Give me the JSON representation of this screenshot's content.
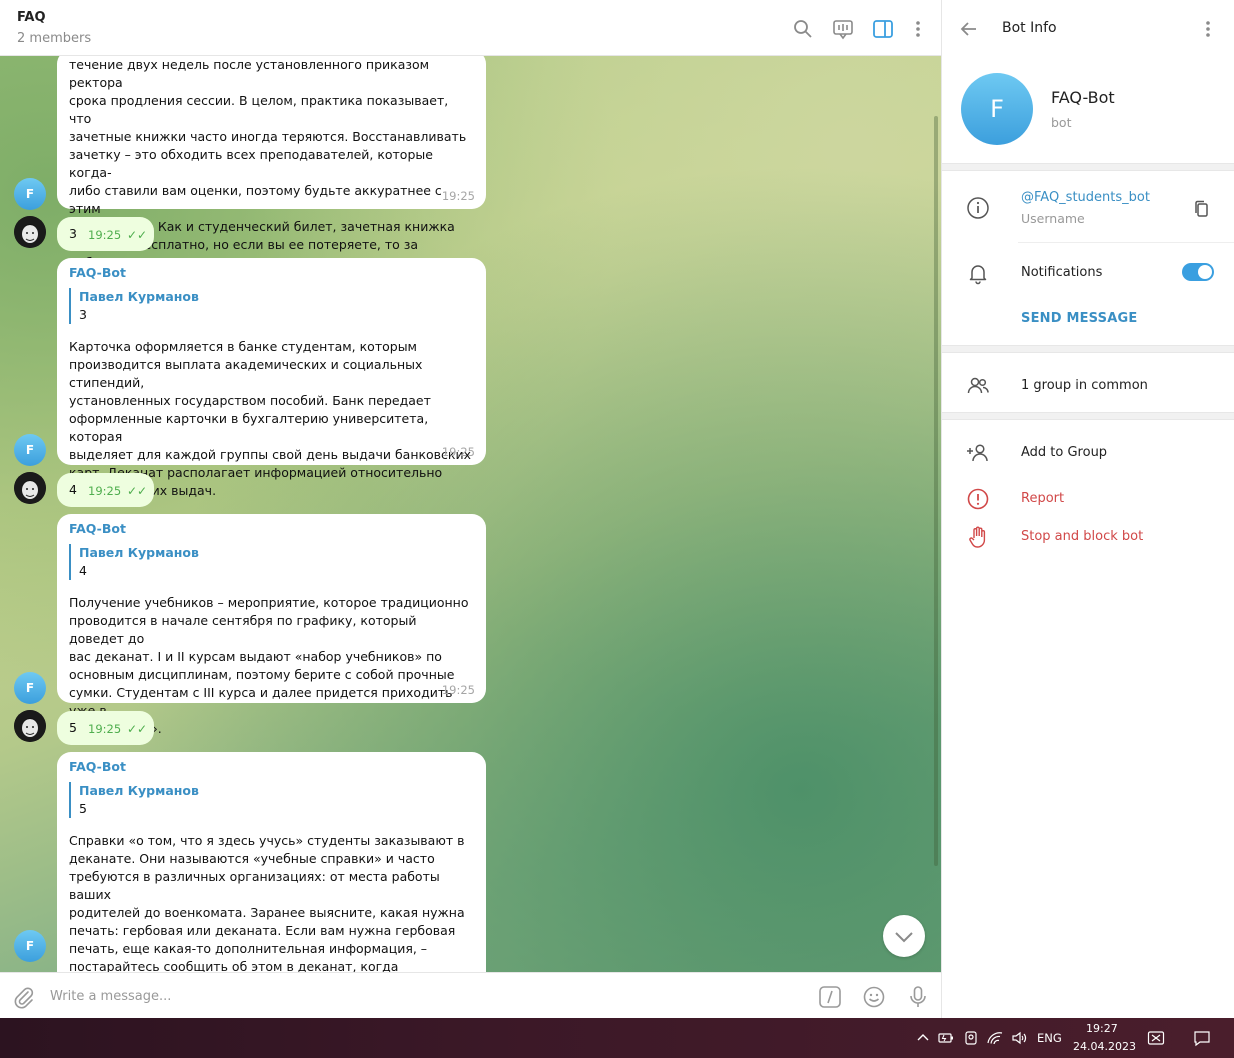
{
  "chat": {
    "title": "FAQ",
    "subtitle": "2 members",
    "header_icons": [
      "search-icon",
      "video-chat-icon",
      "sidebar-toggle-icon",
      "more-vert-icon"
    ],
    "compose_placeholder": "Write a message..."
  },
  "messages": {
    "m1": {
      "text": "течение двух недель после установленного приказом ректора\nсрока продления сессии. В целом, практика показывает, что\nзачетные книжки часто иногда теряются. Восстанавливать\nзачетку – это обходить всех преподавателей, которые когда-\nлибо ставили вам оценки, поэтому будьте аккуратнее с этим\nдокументом. Как и студенческий билет, зачетная книжка\nвыдается бесплатно, но если вы ее потеряете, то за дубликат\nзачетной книжки придется заплатить.",
      "time": "19:25",
      "avatar": "F"
    },
    "o1": {
      "text": "3",
      "time": "19:25"
    },
    "m2": {
      "sender": "FAQ-Bot",
      "reply_name": "Павел Курманов",
      "reply_text": "3",
      "text": "Карточка оформляется в банке студентам, которым\nпроизводится выплата академических и социальных стипендий,\nустановленных государством пособий. Банк передает\nоформленные карточки в бухгалтерию университета, которая\nвыделяет для каждой группы свой день выдачи банковских\nкарт. Деканат  располагает информацией относительно\nграфика таких выдач.",
      "time": "19:25",
      "avatar": "F"
    },
    "o2": {
      "text": "4",
      "time": "19:25"
    },
    "m3": {
      "sender": "FAQ-Bot",
      "reply_name": "Павел Курманов",
      "reply_text": "4",
      "text": "Получение учебников – мероприятие, которое традиционно\nпроводится в начале сентября по графику, который доведет до\nвас деканат. I и II курсам выдают «набор учебников» по\nосновным дисциплинам, поэтому берите с собой прочные\nсумки. Студентам с III курса и далее придется приходить уже в\n«свой» день».",
      "time": "19:25",
      "avatar": "F"
    },
    "o3": {
      "text": "5",
      "time": "19:25"
    },
    "m4": {
      "sender": "FAQ-Bot",
      "reply_name": "Павел Курманов",
      "reply_text": "5",
      "text": "Справки «о том, что я здесь учусь» студенты заказывают в\nдеканате. Они называются «учебные справки» и часто\nтребуются в различных организациях: от места работы ваших\nродителей до военкомата. Заранее выясните, какая нужна\nпечать: гербовая или деканата. Если вам нужна гербовая\nпечать, еще какая-то дополнительная информация, –\nпостарайтесь сообщить об этом в деканат, когда заказываете\nсправку, а не когда вы ее получаете! Печать деканата ставится",
      "avatar": "F"
    }
  },
  "info": {
    "title": "Bot Info",
    "avatar_letter": "F",
    "name": "FAQ-Bot",
    "kind": "bot",
    "username": "@FAQ_students_bot",
    "username_label": "Username",
    "notifications_label": "Notifications",
    "notifications_on": true,
    "send_message": "SEND MESSAGE",
    "groups_common": "1 group in common",
    "add_to_group": "Add to Group",
    "report": "Report",
    "stop_block": "Stop and block bot",
    "accent_color": "#3a8fc4",
    "danger_color": "#d14848"
  },
  "taskbar": {
    "lang": "ENG",
    "time": "19:27",
    "date": "24.04.2023"
  }
}
